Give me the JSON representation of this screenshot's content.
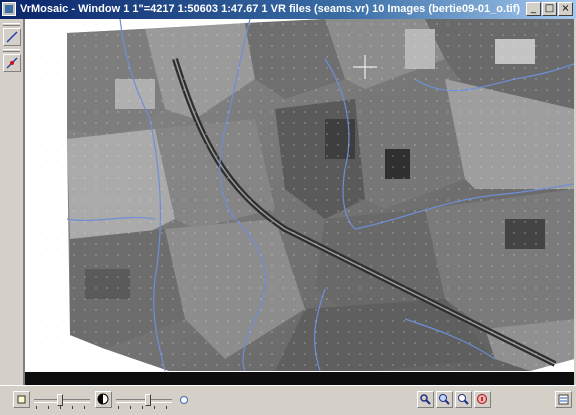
{
  "window": {
    "title": "VrMosaic - Window 1   1\"=4217   1:50603   1:47.67   1 VR files (seams.vr)   10 Images (bertie09-01_o.tif) (bertie09-0...",
    "buttons": [
      "_",
      "□",
      "×"
    ]
  },
  "left_toolbar": {
    "tools": [
      {
        "name": "draw-line-tool",
        "icon": "pencil-line-icon"
      },
      {
        "name": "edit-seam-tool",
        "icon": "red-blue-pen-icon"
      }
    ]
  },
  "viewport": {
    "content": "orthophoto-mosaic",
    "seam_color": "#6c8fd8",
    "cursor": "crosshair"
  },
  "bottom_toolbar": {
    "brightness_icon": "brightness-square-icon",
    "contrast_icon": "contrast-circle-icon",
    "brightness_level": 0.45,
    "contrast_level": 0.55,
    "right_buttons": [
      "pan-icon",
      "zoom-in-icon",
      "zoom-fit-icon",
      "info-icon"
    ],
    "far_right_button": "layers-icon"
  }
}
